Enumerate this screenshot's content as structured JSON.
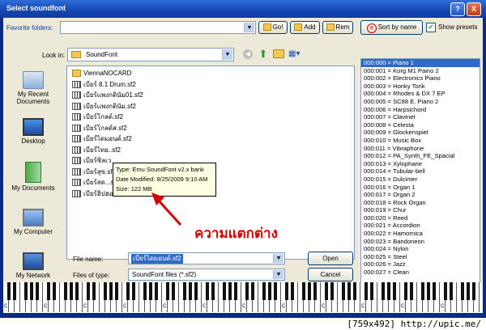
{
  "window": {
    "title": "Select soundfont",
    "help": "?",
    "close": "X"
  },
  "favorites": {
    "label": "Favorite folders:",
    "value": "",
    "go_label": "Go!",
    "add_label": "Add",
    "remove_label": "Rem"
  },
  "sort": {
    "icon_letter": "a",
    "label": "Sort by name"
  },
  "show_presets": {
    "label": "Show presets",
    "checked": true
  },
  "look_in": {
    "label": "Look in:",
    "value": "SoundFont"
  },
  "places": [
    {
      "label": "My Recent Documents",
      "icon": "recent-documents-icon"
    },
    {
      "label": "Desktop",
      "icon": "desktop-icon"
    },
    {
      "label": "My Documents",
      "icon": "my-documents-icon"
    },
    {
      "label": "My Computer",
      "icon": "my-computer-icon"
    },
    {
      "label": "My Network",
      "icon": "my-network-icon"
    }
  ],
  "files": [
    {
      "name": "ViennaNOCARD",
      "type": "folder"
    },
    {
      "name": "เบียร์ 8.1 Drum.sf2",
      "type": "file"
    },
    {
      "name": "เบียร์แพงกตินัม01.sf2",
      "type": "file"
    },
    {
      "name": "เบียร์แพงกตินัม.sf2",
      "type": "file"
    },
    {
      "name": "เบียร์โกลด์.sf2",
      "type": "file"
    },
    {
      "name": "เบียร์โกลด์ส.sf2",
      "type": "file"
    },
    {
      "name": "เบียร์ไดมอนด์.sf2",
      "type": "file"
    },
    {
      "name": "เบียร์ไทย..sf2",
      "type": "file"
    },
    {
      "name": "เบียร์ซิลเว",
      "type": "file"
    },
    {
      "name": "เบียร์สุข.sf2",
      "type": "file"
    },
    {
      "name": "เบียร์สด...sf2",
      "type": "file"
    },
    {
      "name": "เบียร์ฮิปฮอป.sf2",
      "type": "file"
    }
  ],
  "tooltip": {
    "line1": "Type: Emu SoundFont v2.x bank",
    "line2": "Date Modified: 8/25/2009 9:10 AM",
    "line3": "Size: 122 MB"
  },
  "annotation": "ความแตกต่าง",
  "file_name": {
    "label": "File name:",
    "value": "เบียร์ไดมอนด์.sf2"
  },
  "file_type": {
    "label": "Files of type:",
    "value": "SoundFont files (*.sf2)"
  },
  "open_label": "Open",
  "cancel_label": "Cancel",
  "presets": [
    "000:000 = Piano 1",
    "000:001 = Korg M1 Paino 2",
    "000:002 = Electronics Piano",
    "000:003 = Honky Tonk",
    "000:004 = Rhodes & DX 7 EP",
    "000:005 = SC88 E. Piano 2",
    "000:006 = Harpsichord",
    "000:007 = Clavinet",
    "000:008 = Celesta",
    "000:009 = Glockenspiel",
    "000:010 = Music Box",
    "000:011 = Vibraphone",
    "000:012 = PA_Synth_FE_Spacial",
    "000:013 = Xylophane",
    "000:014 = Tubular-bell",
    "000:015 = Dulcimer",
    "000:016 = Organ 1",
    "000:017 = Organ 2",
    "000:018 = Rock Organ",
    "000:019 = Chur",
    "000:020 = Reed",
    "000:021 = Accordion",
    "000:022 = Hamornica",
    "000:023 = Bandoneon",
    "000:024 = Nylon",
    "000:025 = Steel",
    "000:026 = Jazz",
    "000:027 = Clean"
  ],
  "piano": {
    "c_label": "C"
  },
  "footer": {
    "watermark": "[759x492] http://upic.me/"
  }
}
